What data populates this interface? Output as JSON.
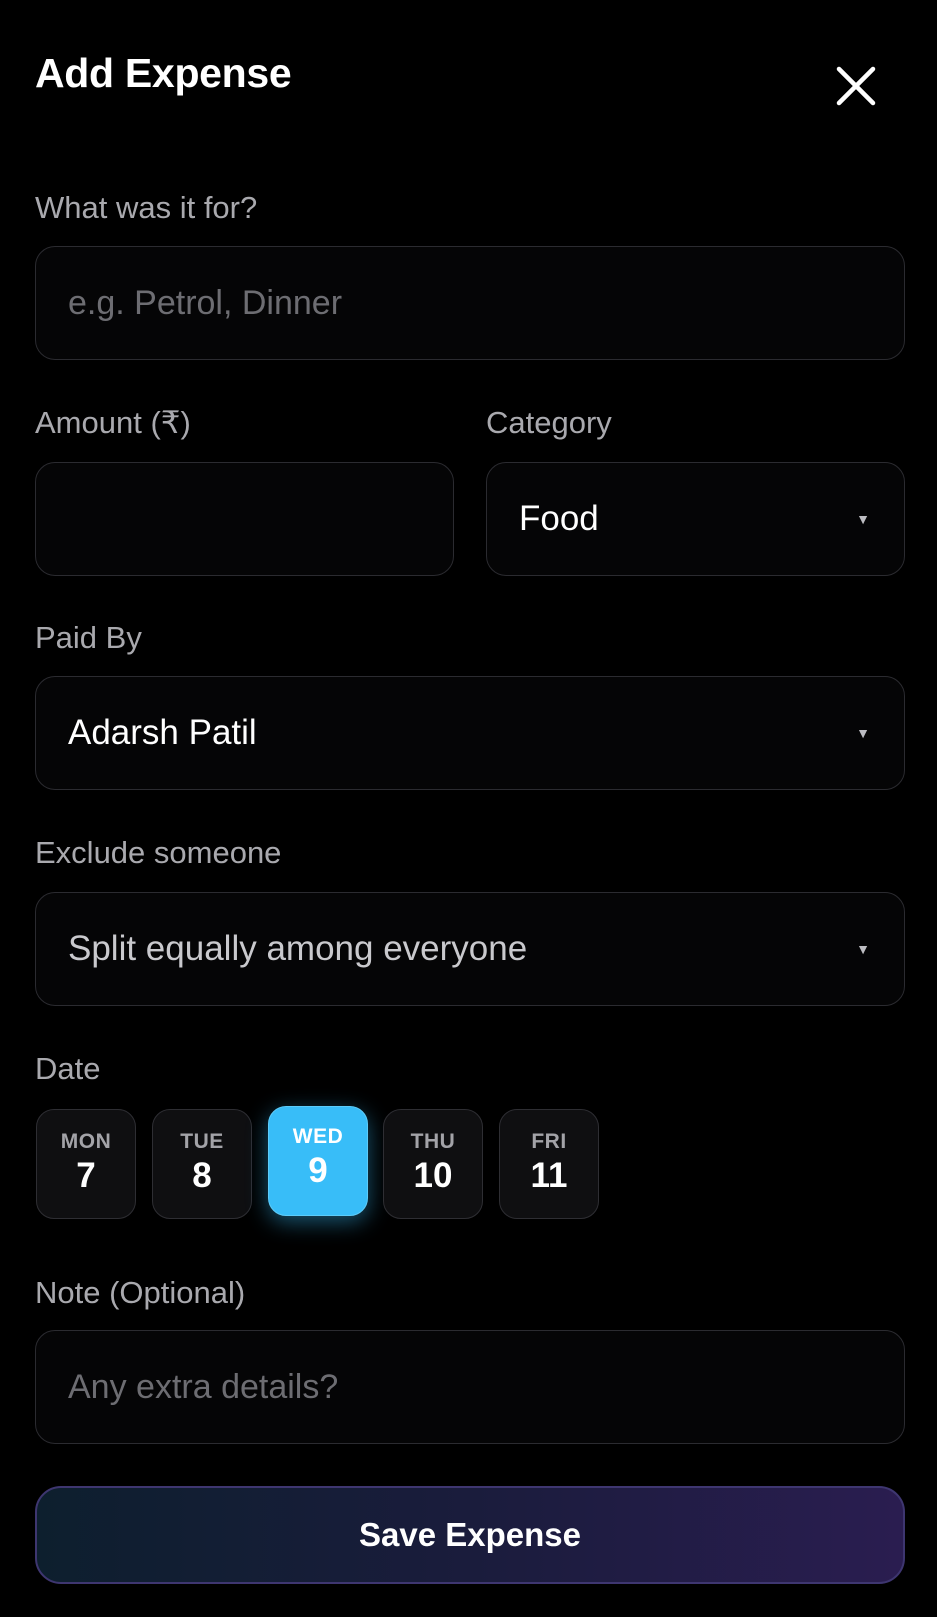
{
  "header": {
    "title": "Add Expense",
    "close_icon": "close-icon"
  },
  "description": {
    "label": "What was it for?",
    "placeholder": "e.g. Petrol, Dinner",
    "value": ""
  },
  "amount": {
    "label": "Amount (₹)",
    "value": ""
  },
  "category": {
    "label": "Category",
    "value": "Food"
  },
  "paid_by": {
    "label": "Paid By",
    "value": "Adarsh Patil"
  },
  "exclude": {
    "label": "Exclude someone",
    "value": "Split equally among everyone"
  },
  "date": {
    "label": "Date",
    "days": [
      {
        "dow": "MON",
        "num": "7"
      },
      {
        "dow": "TUE",
        "num": "8"
      },
      {
        "dow": "WED",
        "num": "9",
        "selected": true
      },
      {
        "dow": "THU",
        "num": "10"
      },
      {
        "dow": "FRI",
        "num": "11"
      }
    ],
    "selected_color": "#38bdf8"
  },
  "note": {
    "label": "Note (Optional)",
    "placeholder": "Any extra details?",
    "value": ""
  },
  "save": {
    "label": "Save Expense"
  },
  "caret_glyph": "▼"
}
